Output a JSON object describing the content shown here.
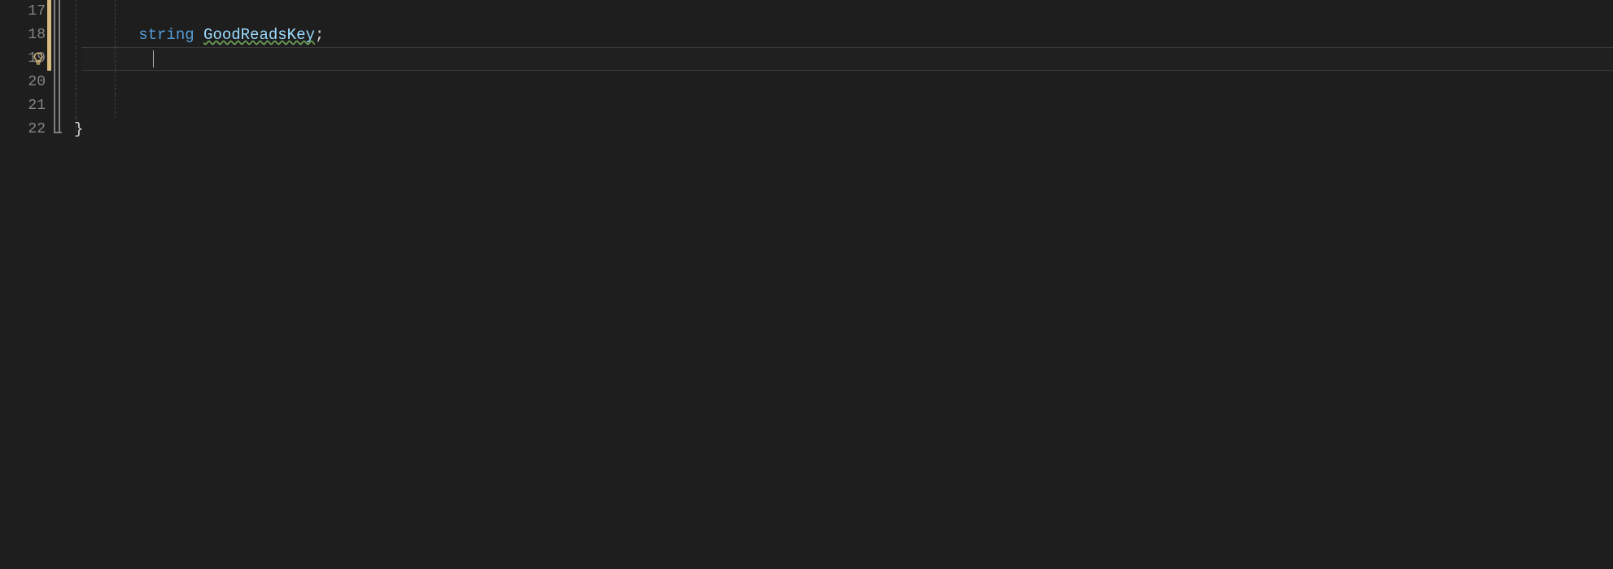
{
  "editor": {
    "lines": {
      "17": {
        "number": "17"
      },
      "18": {
        "number": "18",
        "keyword": "string",
        "identifier": "GoodReadsKey",
        "punct": ";"
      },
      "19": {
        "number": "19"
      },
      "20": {
        "number": "20"
      },
      "21": {
        "number": "21"
      },
      "22": {
        "number": "22",
        "brace": "}"
      }
    },
    "indent": "        "
  },
  "icons": {
    "lightbulb": "lightbulb-icon"
  }
}
